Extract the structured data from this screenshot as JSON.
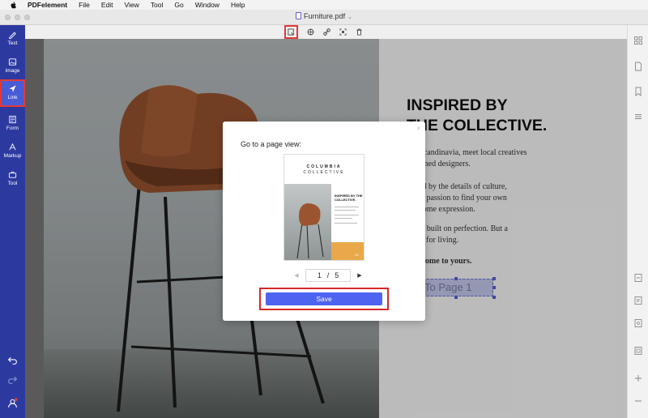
{
  "menubar": {
    "app_name": "PDFelement",
    "items": [
      "File",
      "Edit",
      "View",
      "Tool",
      "Go",
      "Window",
      "Help"
    ]
  },
  "window": {
    "doc_title": "Furniture.pdf"
  },
  "left_sidebar": {
    "tools": [
      {
        "label": "Text",
        "icon": "text-edit-icon"
      },
      {
        "label": "Image",
        "icon": "image-icon"
      },
      {
        "label": "Link",
        "icon": "link-arrow-icon",
        "active": true
      },
      {
        "label": "Form",
        "icon": "form-icon"
      },
      {
        "label": "Markup",
        "icon": "markup-icon"
      },
      {
        "label": "Tool",
        "icon": "toolbox-icon"
      }
    ]
  },
  "document": {
    "heading_line1": "INSPIRED BY",
    "heading_line2": "THE COLLECTIVE.",
    "paragraphs": [
      "ore Scandinavia, meet local creatives",
      "enowned designers.",
      "spired by the details of culture,",
      "n and passion to find your own",
      "nal home expression.",
      "space built on perfection. But a",
      "made for living."
    ],
    "bold_line": "our home to yours.",
    "link_text": "To Page 1"
  },
  "modal": {
    "label": "Go to a page view:",
    "close_glyph": "×",
    "thumbnail": {
      "brand_line1": "COLUMBIA",
      "brand_line2": "COLLECTIVE",
      "heading": "INSPIRED BY THE COLLECTIVE.",
      "badge": "01"
    },
    "pager": {
      "current": "1",
      "separator": "/",
      "total": "5"
    },
    "save_label": "Save"
  },
  "colors": {
    "sidebar": "#2c3aa0",
    "accent": "#4e63f0",
    "highlight": "#d62828"
  }
}
